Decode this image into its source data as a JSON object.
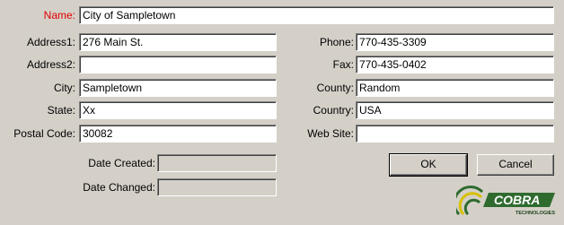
{
  "form": {
    "name": {
      "label": "Name:",
      "value": "City of Sampletown"
    },
    "address1": {
      "label": "Address1:",
      "value": "276 Main St."
    },
    "address2": {
      "label": "Address2:",
      "value": ""
    },
    "city": {
      "label": "City:",
      "value": "Sampletown"
    },
    "state": {
      "label": "State:",
      "value": "Xx"
    },
    "postal_code": {
      "label": "Postal Code:",
      "value": "30082"
    },
    "phone": {
      "label": "Phone:",
      "value": "770-435-3309"
    },
    "fax": {
      "label": "Fax:",
      "value": "770-435-0402"
    },
    "county": {
      "label": "County:",
      "value": "Random"
    },
    "country": {
      "label": "Country:",
      "value": "USA"
    },
    "web_site": {
      "label": "Web Site:",
      "value": ""
    },
    "date_created": {
      "label": "Date Created:",
      "value": ""
    },
    "date_changed": {
      "label": "Date Changed:",
      "value": ""
    }
  },
  "buttons": {
    "ok": "OK",
    "cancel": "Cancel"
  },
  "logo": {
    "text": "COBRA",
    "subtext": "TECHNOLOGIES"
  },
  "colors": {
    "background": "#d4d0c8",
    "name_label": "#e00000"
  }
}
